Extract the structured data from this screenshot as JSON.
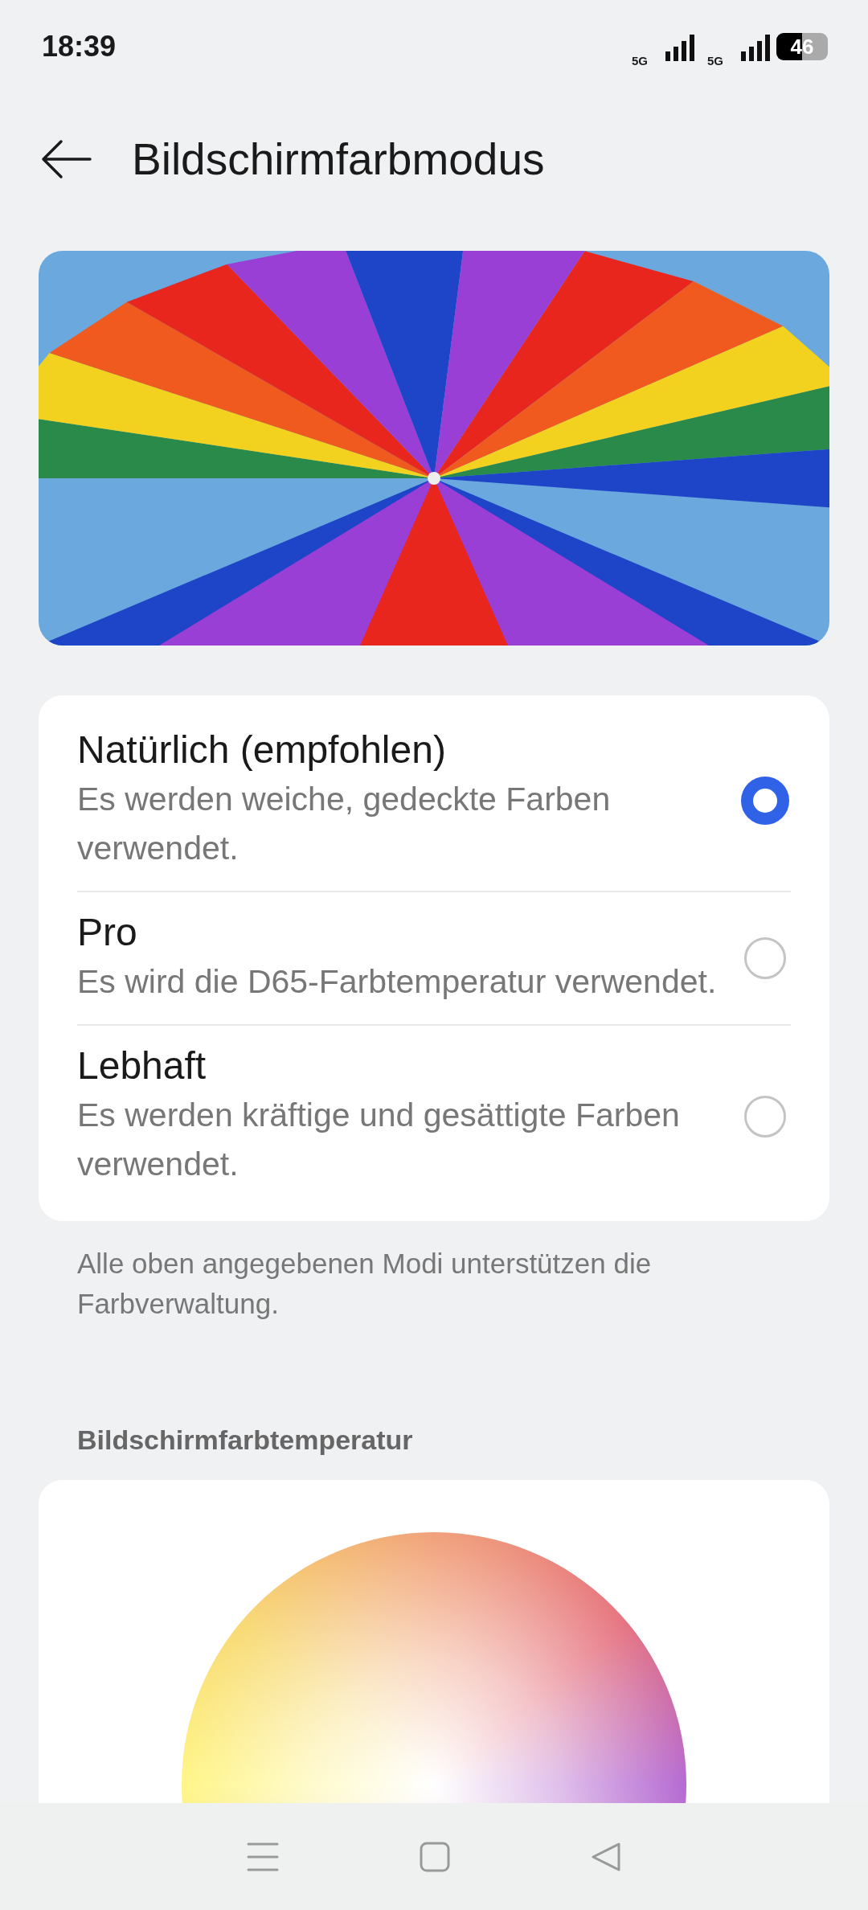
{
  "status_bar": {
    "time": "18:39",
    "network_labels": [
      "5G",
      "5G"
    ],
    "battery": "46"
  },
  "header": {
    "title": "Bildschirmfarbmodus"
  },
  "modes": [
    {
      "title": "Natürlich (empfohlen)",
      "description": "Es werden weiche, gedeckte Farben verwendet.",
      "selected": true
    },
    {
      "title": "Pro",
      "description": "Es wird die D65-Farbtemperatur verwendet.",
      "selected": false
    },
    {
      "title": "Lebhaft",
      "description": "Es werden kräftige und gesättigte Farben verwendet.",
      "selected": false
    }
  ],
  "footnote": "Alle oben angegebenen Modi unterstützen die Farbverwaltung.",
  "temperature_section": {
    "label": "Bildschirmfarbtemperatur"
  }
}
